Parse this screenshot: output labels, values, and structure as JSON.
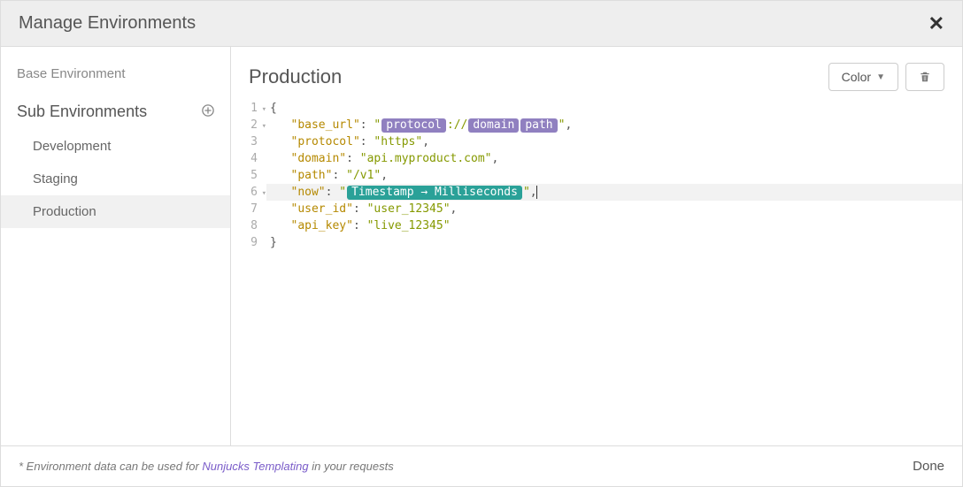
{
  "header": {
    "title": "Manage Environments"
  },
  "sidebar": {
    "base_label": "Base Environment",
    "sub_label": "Sub Environments",
    "items": [
      {
        "label": "Development"
      },
      {
        "label": "Staging"
      },
      {
        "label": "Production"
      }
    ],
    "active_index": 2
  },
  "main": {
    "title": "Production",
    "color_button": "Color"
  },
  "editor": {
    "active_line": 6,
    "lines": [
      "{",
      "\"base_url\": \"{{protocol}}://{{domain}}{{path}}\",",
      "\"protocol\": \"https\",",
      "\"domain\": \"api.myproduct.com\",",
      "\"path\": \"/v1\",",
      "\"now\": \"{{Timestamp -> Milliseconds}}\",",
      "\"user_id\": \"user_12345\",",
      "\"api_key\": \"live_12345\"",
      "}"
    ],
    "json_keys": [
      "base_url",
      "protocol",
      "domain",
      "path",
      "now",
      "user_id",
      "api_key"
    ],
    "json_values": {
      "protocol": "https",
      "domain": "api.myproduct.com",
      "path": "/v1",
      "user_id": "user_12345",
      "api_key": "live_12345"
    },
    "tags": {
      "protocol": "protocol",
      "domain": "domain",
      "path": "path",
      "timestamp": "Timestamp → Milliseconds"
    }
  },
  "footer": {
    "note_prefix": "* Environment data can be used for ",
    "note_link": "Nunjucks Templating",
    "note_suffix": " in your requests",
    "done": "Done"
  }
}
